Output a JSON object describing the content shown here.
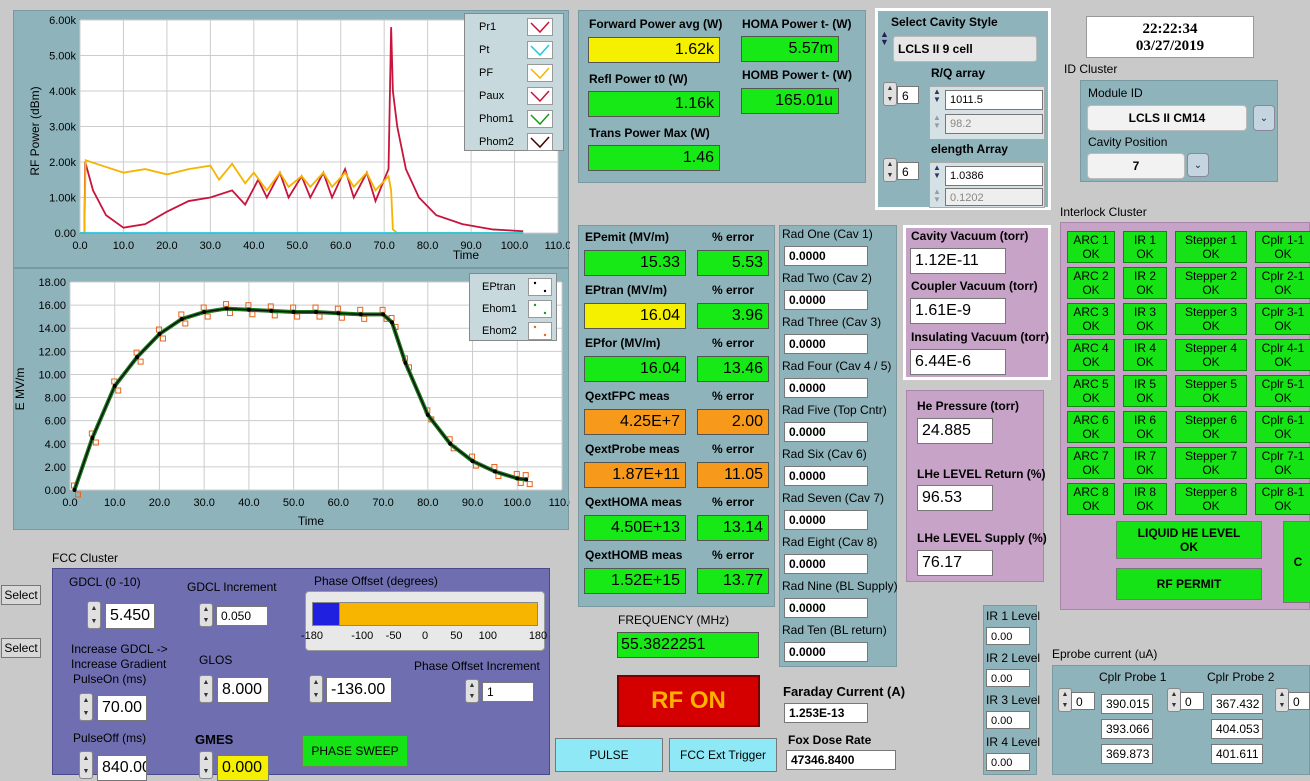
{
  "clock": {
    "time": "22:22:34",
    "date": "03/27/2019"
  },
  "chart_rf": {
    "ylabel": "RF Power (dBm)",
    "xlabel": "Time",
    "yticks": [
      "6.00k",
      "5.00k",
      "4.00k",
      "3.00k",
      "2.00k",
      "1.00k",
      "0.00"
    ],
    "xticks": [
      "0.0",
      "10.0",
      "20.0",
      "30.0",
      "40.0",
      "50.0",
      "60.0",
      "70.0",
      "80.0",
      "90.0",
      "100.0",
      "110.0"
    ],
    "legend": [
      "Pr1",
      "Pt",
      "PF",
      "Paux",
      "Phom1",
      "Phom2"
    ]
  },
  "chart_e": {
    "ylabel": "E MV/m",
    "xlabel": "Time",
    "yticks": [
      "18.00",
      "16.00",
      "14.00",
      "12.00",
      "10.00",
      "8.00",
      "6.00",
      "4.00",
      "2.00",
      "0.00"
    ],
    "xticks": [
      "0.0",
      "10.0",
      "20.0",
      "30.0",
      "40.0",
      "50.0",
      "60.0",
      "70.0",
      "80.0",
      "90.0",
      "100.0",
      "110.0"
    ],
    "legend": [
      "EPtran",
      "Ehom1",
      "Ehom2"
    ]
  },
  "chart_data": [
    {
      "type": "line",
      "ylabel": "RF Power (dBm)",
      "xlabel": "Time",
      "xlim": [
        0,
        110
      ],
      "ylim": [
        0,
        6000
      ],
      "series": [
        {
          "name": "Pr1",
          "x": [
            0,
            1,
            1.2,
            3,
            6,
            10,
            15,
            20,
            25,
            30,
            35,
            38,
            41,
            43,
            46,
            48,
            51,
            53,
            56,
            58,
            61,
            63,
            66,
            68,
            71,
            71.6,
            72,
            73,
            75,
            78,
            82,
            88,
            95,
            102
          ],
          "y": [
            0,
            0,
            2000,
            1200,
            500,
            150,
            250,
            600,
            900,
            1000,
            1200,
            800,
            1500,
            1000,
            1700,
            1000,
            1600,
            1000,
            1700,
            1000,
            1800,
            1000,
            1700,
            900,
            1800,
            5800,
            4000,
            3000,
            1800,
            1000,
            500,
            250,
            100,
            50
          ]
        },
        {
          "name": "PF",
          "x": [
            0,
            1,
            1.3,
            5,
            10,
            15,
            20,
            25,
            30,
            32,
            35,
            38,
            40,
            43,
            46,
            48,
            51,
            53,
            56,
            58,
            61,
            63,
            66,
            68,
            71,
            71.6,
            72,
            73,
            102
          ],
          "y": [
            0,
            0,
            2050,
            1900,
            1700,
            1800,
            1650,
            1800,
            1900,
            1500,
            1950,
            1400,
            1700,
            1200,
            1700,
            1300,
            1600,
            1300,
            1700,
            1300,
            1700,
            1300,
            1700,
            1200,
            1600,
            1200,
            100,
            0,
            0
          ]
        },
        {
          "name": "Pt",
          "x": [
            0,
            102
          ],
          "y": [
            0,
            0
          ]
        }
      ]
    },
    {
      "type": "scatter",
      "ylabel": "E MV/m",
      "xlabel": "Time",
      "xlim": [
        0,
        110
      ],
      "ylim": [
        0,
        18
      ],
      "series": [
        {
          "name": "EPtran",
          "x": [
            1,
            5,
            10,
            15,
            20,
            25,
            30,
            35,
            40,
            45,
            50,
            55,
            60,
            65,
            70,
            72,
            75,
            80,
            85,
            90,
            95,
            100,
            102
          ],
          "y": [
            0,
            4.5,
            9,
            11.5,
            13.5,
            14.8,
            15.4,
            15.7,
            15.6,
            15.5,
            15.4,
            15.4,
            15.3,
            15.2,
            15.2,
            14.5,
            11,
            6.5,
            4,
            2.5,
            1.6,
            1.0,
            0.9
          ]
        }
      ]
    }
  ],
  "forward": {
    "title": "Forward Power avg (W)",
    "value": "1.62k",
    "refl_title": "Refl Power t0 (W)",
    "refl_value": "1.16k",
    "trans_title": "Trans Power Max (W)",
    "trans_value": "1.46",
    "homa_title": "HOMA Power t- (W)",
    "homa_value": "5.57m",
    "homb_title": "HOMB Power t- (W)",
    "homb_value": "165.01u"
  },
  "cavity_style": {
    "title": "Select Cavity Style",
    "value": "LCLS II 9 cell",
    "rq_title": "R/Q array",
    "rq_index": "6",
    "rq_values": [
      "1011.5",
      "98.2"
    ],
    "elength_title": "elength Array",
    "el_index": "6",
    "el_values": [
      "1.0386",
      "0.1202"
    ]
  },
  "id_cluster": {
    "title": "ID Cluster",
    "module_label": "Module ID",
    "module_value": "LCLS II CM14",
    "cavity_label": "Cavity Position",
    "cavity_value": "7"
  },
  "ep": {
    "rows": [
      {
        "name": "EPemit (MV/m)",
        "value": "15.33",
        "err_label": "% error",
        "err": "5.53",
        "color": "green",
        "errcolor": "green"
      },
      {
        "name": "EPtran (MV/m)",
        "value": "16.04",
        "err_label": "% error",
        "err": "3.96",
        "color": "yellow",
        "errcolor": "green"
      },
      {
        "name": "EPfor (MV/m)",
        "value": "16.04",
        "err_label": "% error",
        "err": "13.46",
        "color": "green",
        "errcolor": "green"
      },
      {
        "name": "QextFPC meas",
        "value": "4.25E+7",
        "err_label": "% error",
        "err": "2.00",
        "color": "orange",
        "errcolor": "orange"
      },
      {
        "name": "QextProbe meas",
        "value": "1.87E+11",
        "err_label": "% error",
        "err": "11.05",
        "color": "orange",
        "errcolor": "orange"
      },
      {
        "name": "QextHOMA meas",
        "value": "4.50E+13",
        "err_label": "% error",
        "err": "13.14",
        "color": "green",
        "errcolor": "green"
      },
      {
        "name": "QextHOMB meas",
        "value": "1.52E+15",
        "err_label": "% error",
        "err": "13.77",
        "color": "green",
        "errcolor": "green"
      }
    ],
    "freq_label": "FREQUENCY (MHz)",
    "freq_value": "55.3822251"
  },
  "rad": {
    "items": [
      {
        "label": "Rad One (Cav 1)",
        "value": "0.0000"
      },
      {
        "label": "Rad Two (Cav 2)",
        "value": "0.0000"
      },
      {
        "label": "Rad Three (Cav 3)",
        "value": "0.0000"
      },
      {
        "label": "Rad Four (Cav 4 / 5)",
        "value": "0.0000"
      },
      {
        "label": "Rad Five (Top Cntr)",
        "value": "0.0000"
      },
      {
        "label": "Rad Six (Cav 6)",
        "value": "0.0000"
      },
      {
        "label": "Rad Seven (Cav 7)",
        "value": "0.0000"
      },
      {
        "label": "Rad Eight (Cav 8)",
        "value": "0.0000"
      },
      {
        "label": "Rad Nine (BL Supply)",
        "value": "0.0000"
      },
      {
        "label": "Rad Ten (BL return)",
        "value": "0.0000"
      }
    ]
  },
  "vacuum": {
    "cav_label": "Cavity Vacuum (torr)",
    "cav_value": "1.12E-11",
    "coup_label": "Coupler Vacuum (torr)",
    "coup_value": "1.61E-9",
    "ins_label": "Insulating Vacuum (torr)",
    "ins_value": "6.44E-6"
  },
  "he": {
    "press_label": "He Pressure (torr)",
    "press_value": "24.885",
    "ret_label": "LHe LEVEL Return (%)",
    "ret_value": "96.53",
    "sup_label": "LHe LEVEL Supply (%)",
    "sup_value": "76.17"
  },
  "interlock": {
    "title": "Interlock Cluster",
    "cols": [
      [
        "ARC 1",
        "ARC 2",
        "ARC 3",
        "ARC 4",
        "ARC 5",
        "ARC 6",
        "ARC 7",
        "ARC 8"
      ],
      [
        "IR 1",
        "IR 2",
        "IR 3",
        "IR 4",
        "IR 5",
        "IR 6",
        "IR 7",
        "IR 8"
      ],
      [
        "Stepper 1",
        "Stepper 2",
        "Stepper 3",
        "Stepper 4",
        "Stepper 5",
        "Stepper 6",
        "Stepper 7",
        "Stepper 8"
      ],
      [
        "Cplr 1-1",
        "Cplr 2-1",
        "Cplr 3-1",
        "Cplr 4-1",
        "Cplr 5-1",
        "Cplr 6-1",
        "Cplr 7-1",
        "Cplr 8-1"
      ]
    ],
    "ok": "OK",
    "liquid_line1": "LIQUID HE LEVEL",
    "liquid_line2": "OK",
    "rf_permit": "RF PERMIT",
    "right_partial": "C"
  },
  "ir_level": {
    "items": [
      {
        "label": "IR 1 Level",
        "value": "0.00"
      },
      {
        "label": "IR 2 Level",
        "value": "0.00"
      },
      {
        "label": "IR 3 Level",
        "value": "0.00"
      },
      {
        "label": "IR 4 Level",
        "value": "0.00"
      }
    ]
  },
  "eprobe": {
    "title": "Eprobe current (uA)",
    "p1_label": "Cplr Probe 1",
    "p1_index": "0",
    "p1_values": [
      "390.015",
      "393.066",
      "369.873"
    ],
    "p2_label": "Cplr Probe 2",
    "p2_index": "0",
    "p2_values": [
      "367.432",
      "404.053",
      "401.611"
    ],
    "p3_index": "0"
  },
  "fcc": {
    "title": "FCC Cluster",
    "select1": "Select",
    "select2": "Select",
    "gdcl_label": "GDCL (0 -10)",
    "gdcl_value": "5.450",
    "gdcl_inc_label": "GDCL Increment",
    "gdcl_inc_value": "0.050",
    "phase_label": "Phase Offset (degrees)",
    "phase_ticks": [
      "-180",
      "-100",
      "-50",
      "0",
      "50",
      "100",
      "180"
    ],
    "phase_fill": -135,
    "increase_line1": "Increase GDCL ->",
    "increase_line2": "Increase Gradient",
    "pulseon_label": "PulseOn (ms)",
    "pulseon_value": "70.00",
    "glos_label": "GLOS",
    "glos_value": "8.000",
    "phase_value": "-136.00",
    "phase_inc_label": "Phase Offset  Increment",
    "phase_inc_value": "1",
    "pulseoff_label": "PulseOff (ms)",
    "pulseoff_value": "840.00",
    "gmes_label": "GMES",
    "gmes_value": "0.000",
    "sweep": "PHASE SWEEP"
  },
  "rf_on": "RF ON",
  "pulse_btn": "PULSE",
  "fcc_trigger": "FCC Ext Trigger",
  "faraday": {
    "label": "Faraday Current (A)",
    "value": "1.253E-13"
  },
  "fox": {
    "label": "Fox Dose Rate",
    "value": "47346.8400"
  }
}
